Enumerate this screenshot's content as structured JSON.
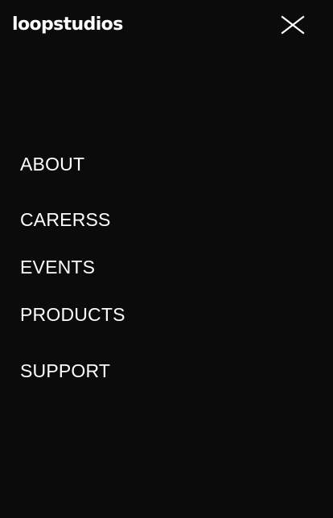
{
  "header": {
    "logo_text": "loopstudios",
    "close_icon": "close-icon"
  },
  "nav": {
    "items": [
      {
        "label": "ABOUT"
      },
      {
        "label": "CARERSS"
      },
      {
        "label": "EVENTS"
      },
      {
        "label": "PRODUCTS"
      },
      {
        "label": "SUPPORT"
      }
    ]
  },
  "colors": {
    "background": "#0b0b0b",
    "text": "#ffffff"
  }
}
